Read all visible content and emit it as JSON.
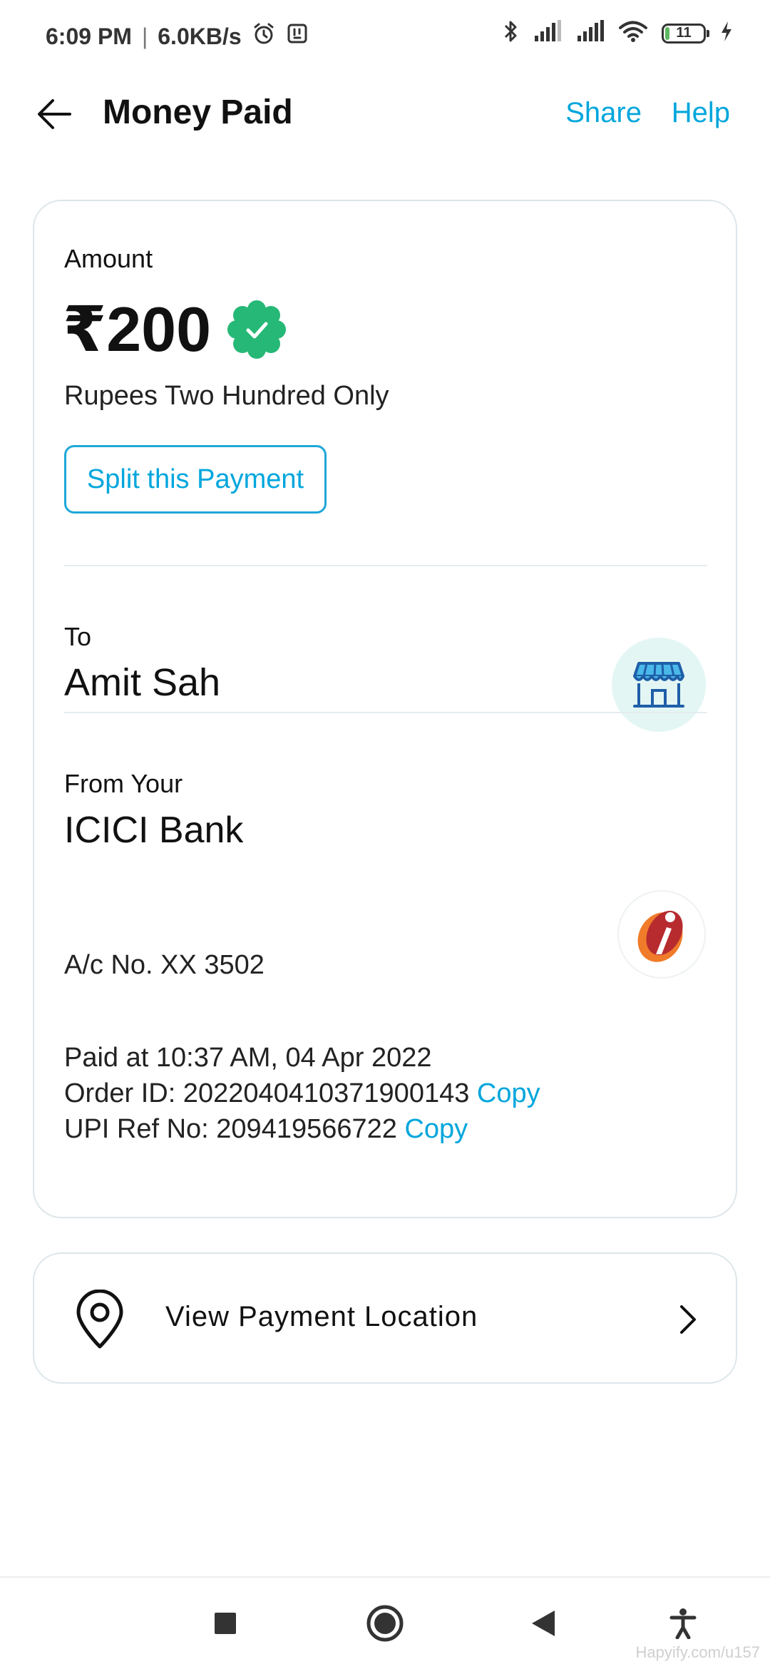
{
  "status_bar": {
    "time": "6:09 PM",
    "separator": "|",
    "network_speed": "6.0KB/s",
    "battery_level": "11",
    "battery_fraction": 0.11,
    "icons": [
      "alarm-icon",
      "notification-icon",
      "bluetooth-icon",
      "signal-icon",
      "signal-icon",
      "wifi-icon",
      "battery-icon",
      "charging-icon"
    ]
  },
  "header": {
    "title": "Money Paid",
    "share_label": "Share",
    "help_label": "Help"
  },
  "amount_section": {
    "label": "Amount",
    "value": "₹200",
    "in_words": "Rupees Two Hundred Only",
    "split_button_label": "Split this Payment"
  },
  "recipient_section": {
    "label": "To",
    "name": "Amit Sah"
  },
  "source_section": {
    "label": "From Your",
    "bank_name": "ICICI Bank",
    "account": "A/c No. XX 3502"
  },
  "transaction": {
    "paid_at": "Paid at 10:37 AM, 04 Apr 2022",
    "order_id_label": "Order ID: 2022040410371900143",
    "upi_ref_label": "UPI Ref No: 209419566722",
    "copy_label": "Copy"
  },
  "location_card": {
    "label": "View Payment Location"
  },
  "watermark": "Hapyify.com/u157",
  "colors": {
    "accent": "#00a6dc",
    "verified_green": "#26b876",
    "card_border": "#dde6ea",
    "store_bg": "#e3f6f4",
    "store_icon": "#1f5fa8",
    "icici_orange": "#f07b2a",
    "icici_red": "#b72b2f"
  }
}
